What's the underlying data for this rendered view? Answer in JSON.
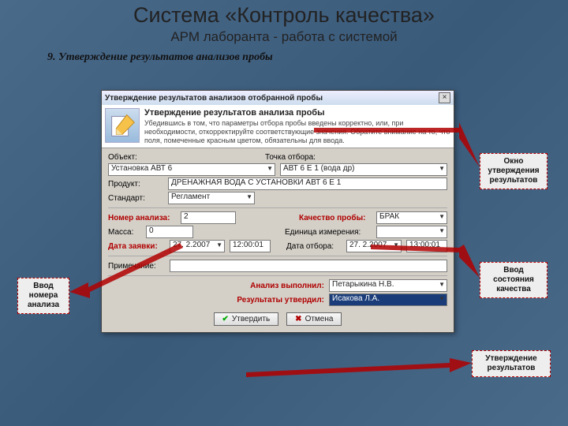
{
  "slide": {
    "title": "Система «Контроль качества»",
    "subtitle": "АРМ лаборанта - работа с системой",
    "step": "9. Утверждение результатов анализов пробы"
  },
  "window": {
    "title": "Утверждение результатов анализов отобранной пробы",
    "close": "×",
    "header_title": "Утверждение результатов анализа пробы",
    "header_desc": "Убедившись в том, что параметры отбора пробы введены корректно, или, при необходимости, откорректируйте соответствующие значения. Обратите внимание на то, что поля, помеченные красным цветом, обязательны для ввода."
  },
  "fields": {
    "object_lbl": "Объект:",
    "object_val": "Установка АВТ 6",
    "point_lbl": "Точка отбора:",
    "point_val": "АВТ 6 Е 1 (вода др)",
    "product_lbl": "Продукт:",
    "product_val": "ДРЕНАЖНАЯ ВОДА С УСТАНОВКИ АВТ 6  Е 1",
    "standard_lbl": "Стандарт:",
    "standard_val": "Регламент",
    "num_lbl": "Номер анализа:",
    "num_val": "2",
    "quality_lbl": "Качество пробы:",
    "quality_val": "БРАК",
    "mass_lbl": "Масса:",
    "mass_val": "0",
    "unit_lbl": "Единица измерения:",
    "unit_val": "",
    "date_req_lbl": "Дата заявки:",
    "date_req_d": "27. 2.2007",
    "date_req_t": "12:00:01",
    "date_sel_lbl": "Дата отбора:",
    "date_sel_d": "27. 2.2007",
    "date_sel_t": "13:00:01",
    "note_lbl": "Примечание:",
    "note_val": "",
    "perf_lbl": "Анализ выполнил:",
    "perf_val": "Петарыкина Н.В.",
    "appr_lbl": "Результаты утвердил:",
    "appr_val": "Исакова Л.А."
  },
  "buttons": {
    "ok_icon": "✔",
    "ok": "Утвердить",
    "cancel_icon": "✖",
    "cancel": "Отмена"
  },
  "callouts": {
    "c1": "Окно утверждения результатов",
    "c2": "Ввод номера анализа",
    "c3": "Ввод состояния качества",
    "c4": "Утверждение результатов"
  }
}
